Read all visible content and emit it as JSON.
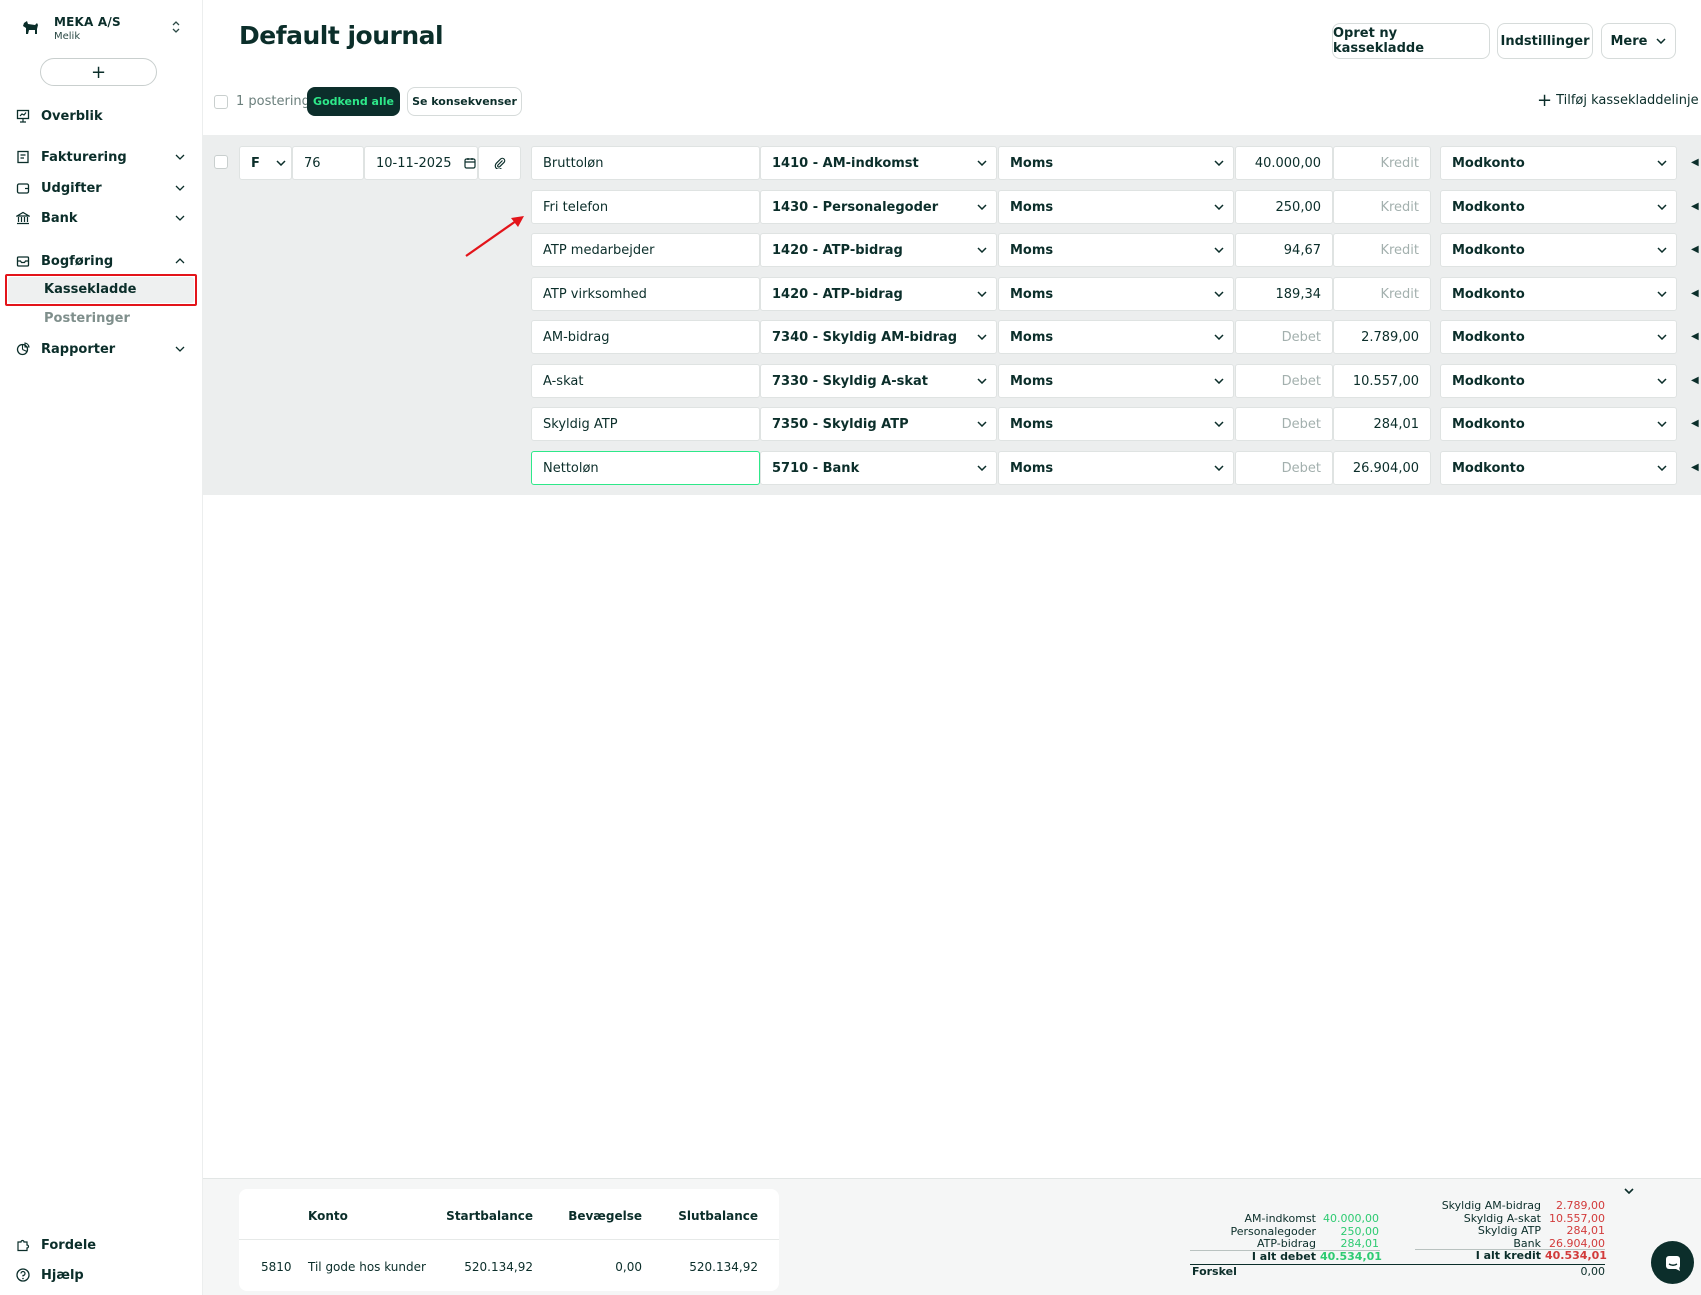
{
  "company": {
    "name": "MEKA A/S",
    "user": "Melik"
  },
  "sidebar": {
    "add_label": "+",
    "overview": "Overblik",
    "invoicing": "Fakturering",
    "expenses": "Udgifter",
    "bank": "Bank",
    "bookkeeping": "Bogføring",
    "journal": "Kassekladde",
    "postings": "Posteringer",
    "reports": "Rapporter",
    "benefits": "Fordele",
    "help": "Hjælp"
  },
  "header": {
    "title": "Default journal",
    "new_journal": "Opret ny kassekladde",
    "settings": "Indstillinger",
    "more": "Mere"
  },
  "toolbar": {
    "count": "1 postering",
    "approve_all": "Godkend alle",
    "see_consequences": "Se konsekvenser",
    "add_line": "Tilføj kassekladdelinje"
  },
  "entry": {
    "type": "F",
    "voucher": "76",
    "date": "10-11-2025"
  },
  "lines": [
    {
      "text": "Bruttoløn",
      "account": "1410 - AM-indkomst",
      "vat": "Moms",
      "debit": "40.000,00",
      "credit": "Kredit",
      "offset": "Modkonto"
    },
    {
      "text": "Fri telefon",
      "account": "1430 - Personalegoder",
      "vat": "Moms",
      "debit": "250,00",
      "credit": "Kredit",
      "offset": "Modkonto"
    },
    {
      "text": "ATP medarbejder",
      "account": "1420 - ATP-bidrag",
      "vat": "Moms",
      "debit": "94,67",
      "credit": "Kredit",
      "offset": "Modkonto"
    },
    {
      "text": "ATP virksomhed",
      "account": "1420 - ATP-bidrag",
      "vat": "Moms",
      "debit": "189,34",
      "credit": "Kredit",
      "offset": "Modkonto"
    },
    {
      "text": "AM-bidrag",
      "account": "7340 - Skyldig AM-bidrag",
      "vat": "Moms",
      "debit": "Debet",
      "credit": "2.789,00",
      "offset": "Modkonto"
    },
    {
      "text": "A-skat",
      "account": "7330 - Skyldig A-skat",
      "vat": "Moms",
      "debit": "Debet",
      "credit": "10.557,00",
      "offset": "Modkonto"
    },
    {
      "text": "Skyldig ATP",
      "account": "7350 - Skyldig ATP",
      "vat": "Moms",
      "debit": "Debet",
      "credit": "284,01",
      "offset": "Modkonto"
    },
    {
      "text": "Nettoløn",
      "account": "5710 - Bank",
      "vat": "Moms",
      "debit": "Debet",
      "credit": "26.904,00",
      "offset": "Modkonto"
    }
  ],
  "account_table": {
    "headers": {
      "account": "Konto",
      "start": "Startbalance",
      "movement": "Bevægelse",
      "end": "Slutbalance"
    },
    "row": {
      "number": "5810",
      "name": "Til gode hos kunder",
      "start": "520.134,92",
      "movement": "0,00",
      "end": "520.134,92"
    }
  },
  "summary": {
    "debit_items": [
      {
        "label": "AM-indkomst",
        "value": "40.000,00"
      },
      {
        "label": "Personalegoder",
        "value": "250,00"
      },
      {
        "label": "ATP-bidrag",
        "value": "284,01"
      }
    ],
    "debit_total_label": "I alt debet",
    "debit_total": "40.534,01",
    "credit_items": [
      {
        "label": "Skyldig AM-bidrag",
        "value": "2.789,00"
      },
      {
        "label": "Skyldig A-skat",
        "value": "10.557,00"
      },
      {
        "label": "Skyldig ATP",
        "value": "284,01"
      },
      {
        "label": "Bank",
        "value": "26.904,00"
      }
    ],
    "credit_total_label": "I alt kredit",
    "credit_total": "40.534,01",
    "difference_label": "Forskel",
    "difference": "0,00"
  },
  "colors": {
    "accent_green": "#2ee889",
    "dark": "#0c2e2b",
    "debit": "#2ecb72",
    "credit": "#d23b3b",
    "highlight": "#e3141a"
  }
}
